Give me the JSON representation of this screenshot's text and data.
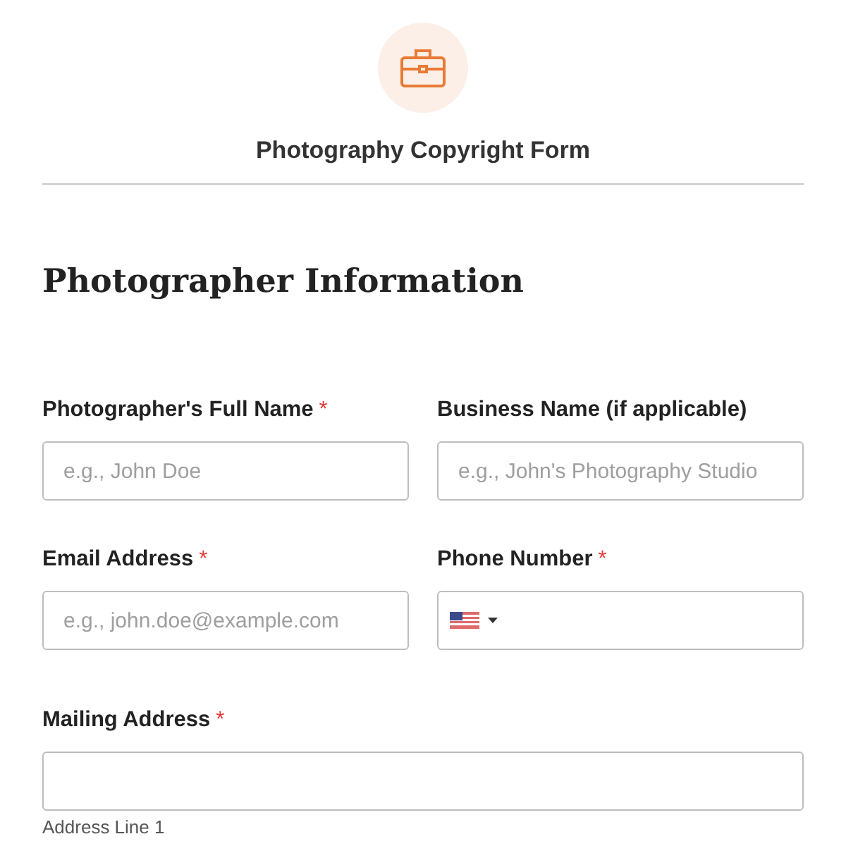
{
  "form_title": "Photography Copyright Form",
  "section_title": "Photographer Information",
  "rows": [
    [
      {
        "kind": "text",
        "label": "Photographer's Full Name",
        "required_mark": "*",
        "placeholder": "e.g., John Doe"
      },
      {
        "kind": "text",
        "label": "Business Name (if applicable)",
        "placeholder": "e.g., John's Photography Studio"
      }
    ],
    [
      {
        "kind": "text",
        "label": "Email Address",
        "required_mark": "*",
        "placeholder": "e.g., john.doe@example.com"
      },
      {
        "kind": "phone",
        "label": "Phone Number",
        "required_mark": "*"
      }
    ]
  ],
  "mailing": {
    "label": "Mailing Address",
    "required_mark": "*",
    "sublabel": "Address Line 1"
  }
}
